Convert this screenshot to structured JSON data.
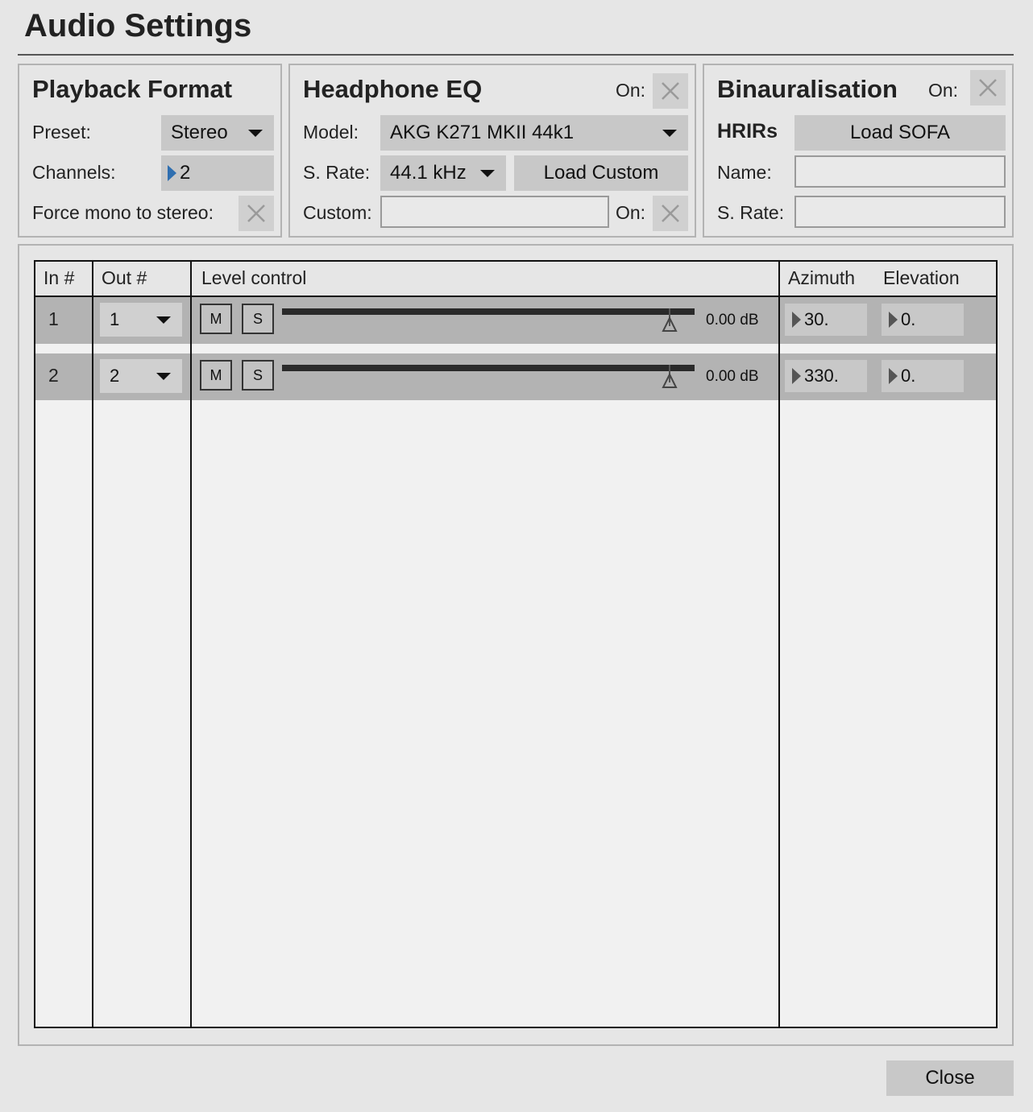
{
  "window": {
    "title": "Audio Settings"
  },
  "playback": {
    "title": "Playback Format",
    "preset_label": "Preset:",
    "preset_value": "Stereo",
    "channels_label": "Channels:",
    "channels_value": "2",
    "force_mono_label": "Force mono to stereo:"
  },
  "headphone_eq": {
    "title": "Headphone EQ",
    "on_label": "On:",
    "model_label": "Model:",
    "model_value": "AKG K271 MKII 44k1",
    "srate_label": "S. Rate:",
    "srate_value": "44.1 kHz",
    "load_custom": "Load Custom",
    "custom_label": "Custom:",
    "custom_value": "",
    "custom_on_label": "On:"
  },
  "binaural": {
    "title": "Binauralisation",
    "on_label": "On:",
    "hrirs_label": "HRIRs",
    "load_sofa": "Load SOFA",
    "name_label": "Name:",
    "name_value": "",
    "srate_label": "S. Rate:",
    "srate_value": ""
  },
  "table": {
    "headers": {
      "in": "In #",
      "out": "Out #",
      "level": "Level control",
      "azimuth": "Azimuth",
      "elevation": "Elevation"
    },
    "rows": [
      {
        "in": "1",
        "out": "1",
        "mute": "M",
        "solo": "S",
        "level_db": "0.00 dB",
        "level_fraction": 0.94,
        "azimuth": "30.",
        "elevation": "0."
      },
      {
        "in": "2",
        "out": "2",
        "mute": "M",
        "solo": "S",
        "level_db": "0.00 dB",
        "level_fraction": 0.94,
        "azimuth": "330.",
        "elevation": "0."
      }
    ]
  },
  "footer": {
    "close": "Close"
  }
}
